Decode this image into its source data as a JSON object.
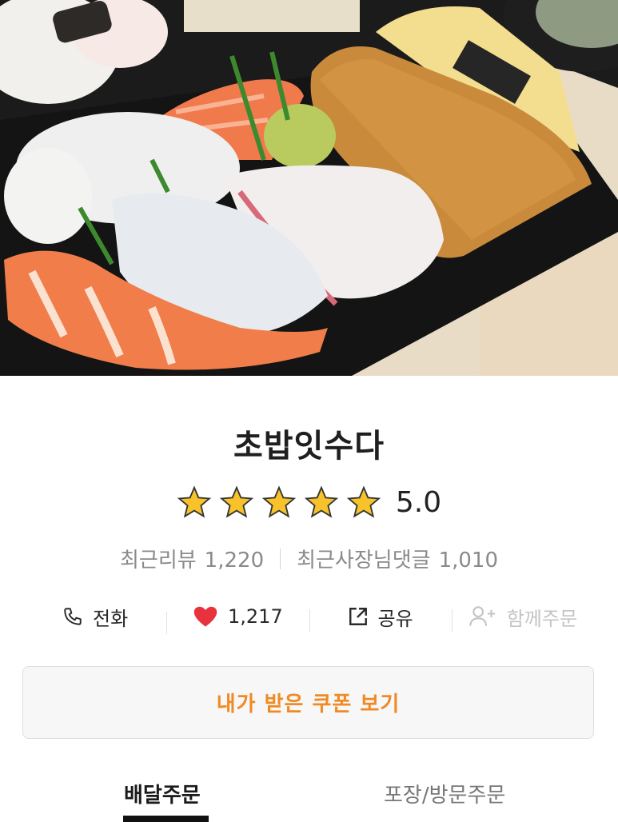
{
  "store": {
    "name": "초밥잇수다",
    "rating": 5.0,
    "rating_text": "5.0",
    "star_count": 5
  },
  "meta": {
    "reviews_label": "최근리뷰",
    "reviews_count": "1,220",
    "owner_replies_label": "최근사장님댓글",
    "owner_replies_count": "1,010"
  },
  "actions": {
    "call_label": "전화",
    "likes_count": "1,217",
    "share_label": "공유",
    "group_order_label": "함께주문"
  },
  "coupon": {
    "label": "내가 받은 쿠폰 보기"
  },
  "tabs": [
    {
      "label": "배달주문",
      "active": true
    },
    {
      "label": "포장/방문주문",
      "active": false
    }
  ],
  "colors": {
    "accent": "#f08a24",
    "heart": "#e8323e",
    "star": "#f7c22a"
  },
  "icons": [
    "phone-icon",
    "heart-icon",
    "share-icon",
    "add-user-icon",
    "star-icon"
  ]
}
